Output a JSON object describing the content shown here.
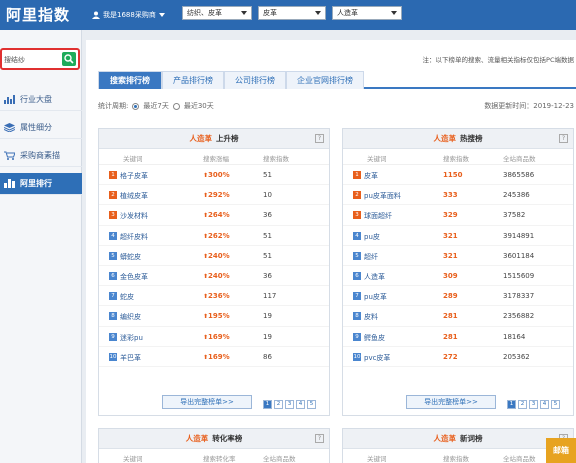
{
  "header": {
    "logo": "阿里指数",
    "user_label": "我是1688采购商",
    "dropdowns": [
      {
        "value": "纺织、皮革"
      },
      {
        "value": "皮革"
      },
      {
        "value": "人造革"
      }
    ]
  },
  "sidebar": {
    "search_text": "搜结纱",
    "items": [
      {
        "label": "行业大盘",
        "icon": "bar-chart-icon"
      },
      {
        "label": "属性细分",
        "icon": "layers-icon"
      },
      {
        "label": "采购商素描",
        "icon": "cart-icon"
      },
      {
        "label": "阿里排行",
        "icon": "ranking-icon",
        "active": true
      }
    ]
  },
  "main": {
    "notice": "注：以下榜单的搜索、流量相关指标仅包括PC端数据",
    "tabs": [
      {
        "label": "搜索排行榜",
        "active": true
      },
      {
        "label": "产品排行榜"
      },
      {
        "label": "公司排行榜"
      },
      {
        "label": "企业官网排行榜"
      }
    ],
    "period_label": "统计周期:",
    "period_options": [
      {
        "label": "最近7天",
        "selected": true
      },
      {
        "label": "最近30天"
      }
    ],
    "updated": "数据更新时间：2019-12-23",
    "pages": [
      "1",
      "2",
      "3",
      "4",
      "5"
    ],
    "more_label": "导出完整榜单>>",
    "panels": [
      {
        "industry": "人造革",
        "title": "上升榜",
        "cols": [
          "关键词",
          "搜索涨幅",
          "搜索指数"
        ],
        "rows": [
          {
            "kw": "格子皮革",
            "v2": "300%",
            "v3": "51"
          },
          {
            "kw": "植绒皮革",
            "v2": "292%",
            "v3": "10"
          },
          {
            "kw": "沙发材料",
            "v2": "264%",
            "v3": "36"
          },
          {
            "kw": "超纤皮料",
            "v2": "262%",
            "v3": "51"
          },
          {
            "kw": "蟒蛇皮",
            "v2": "240%",
            "v3": "51"
          },
          {
            "kw": "金色皮革",
            "v2": "240%",
            "v3": "36"
          },
          {
            "kw": "蛇皮",
            "v2": "236%",
            "v3": "117"
          },
          {
            "kw": "编织皮",
            "v2": "195%",
            "v3": "19"
          },
          {
            "kw": "迷彩pu",
            "v2": "169%",
            "v3": "19"
          },
          {
            "kw": "羊巴革",
            "v2": "169%",
            "v3": "86"
          }
        ]
      },
      {
        "industry": "人造革",
        "title": "热搜榜",
        "cols": [
          "关键词",
          "搜索指数",
          "全站商品数"
        ],
        "rows": [
          {
            "kw": "皮革",
            "v2": "1150",
            "v3": "3865586"
          },
          {
            "kw": "pu皮革面料",
            "v2": "333",
            "v3": "245386"
          },
          {
            "kw": "球面超纤",
            "v2": "329",
            "v3": "37582"
          },
          {
            "kw": "pu皮",
            "v2": "321",
            "v3": "3914891"
          },
          {
            "kw": "超纤",
            "v2": "321",
            "v3": "3601184"
          },
          {
            "kw": "人造革",
            "v2": "309",
            "v3": "1515609"
          },
          {
            "kw": "pu皮革",
            "v2": "289",
            "v3": "3178337"
          },
          {
            "kw": "皮料",
            "v2": "281",
            "v3": "2356882"
          },
          {
            "kw": "鳄鱼皮",
            "v2": "281",
            "v3": "18164"
          },
          {
            "kw": "pvc皮革",
            "v2": "272",
            "v3": "205362"
          }
        ]
      }
    ],
    "bottom_panels": [
      {
        "industry": "人造革",
        "title": "转化率榜",
        "cols": [
          "关键词",
          "搜索转化率",
          "全站商品数"
        ]
      },
      {
        "industry": "人造革",
        "title": "新词榜",
        "cols": [
          "关键词",
          "搜索指数",
          "全站商品数"
        ]
      }
    ]
  },
  "mail_label": "邮箱",
  "colors": {
    "header": "#2b69b1",
    "accent": "#e85f1c",
    "link": "#2e5d99",
    "rank_top": "#e85f1c",
    "rank_rest": "#4a86cf"
  }
}
